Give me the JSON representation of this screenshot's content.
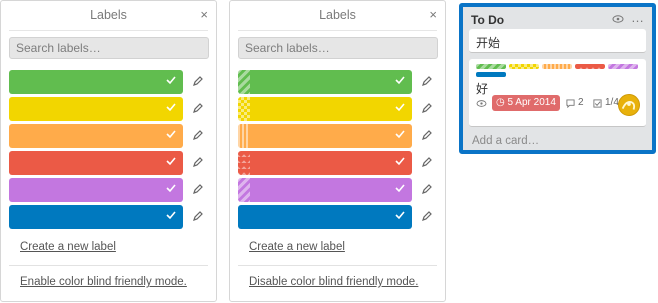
{
  "panels": [
    {
      "title": "Labels",
      "close_glyph": "×",
      "search_placeholder": "Search labels…",
      "labels": [
        {
          "color": "#61bd4f",
          "checked": true
        },
        {
          "color": "#f2d600",
          "checked": true
        },
        {
          "color": "#ffab4a",
          "checked": true
        },
        {
          "color": "#eb5a46",
          "checked": true
        },
        {
          "color": "#c377e0",
          "checked": true
        },
        {
          "color": "#0079bf",
          "checked": true
        }
      ],
      "create_link": "Create a new label",
      "mode_link": "Enable color blind friendly mode."
    },
    {
      "title": "Labels",
      "close_glyph": "×",
      "search_placeholder": "Search labels…",
      "labels": [
        {
          "color": "#61bd4f",
          "checked": true
        },
        {
          "color": "#f2d600",
          "checked": true
        },
        {
          "color": "#ffab4a",
          "checked": true
        },
        {
          "color": "#eb5a46",
          "checked": true
        },
        {
          "color": "#c377e0",
          "checked": true
        },
        {
          "color": "#0079bf",
          "checked": true
        }
      ],
      "create_link": "Create a new label",
      "mode_link": "Disable color blind friendly mode."
    }
  ],
  "board_list": {
    "title": "To Do",
    "menu_glyph": "…",
    "cards": [
      {
        "text": "开始"
      },
      {
        "text": "好",
        "label_colors": [
          "#61bd4f",
          "#f2d600",
          "#ffab4a",
          "#eb5a46",
          "#c377e0",
          "#0079bf"
        ],
        "due_date": "5 Apr 2014",
        "comments": "2",
        "checklist": "1/4"
      }
    ],
    "add_card": "Add a card…"
  },
  "icons": {
    "check": "check-icon",
    "edit": "pencil-icon",
    "watch": "eye-icon",
    "comment": "comment-icon",
    "checklist": "checklist-icon",
    "due": "clock-icon"
  }
}
